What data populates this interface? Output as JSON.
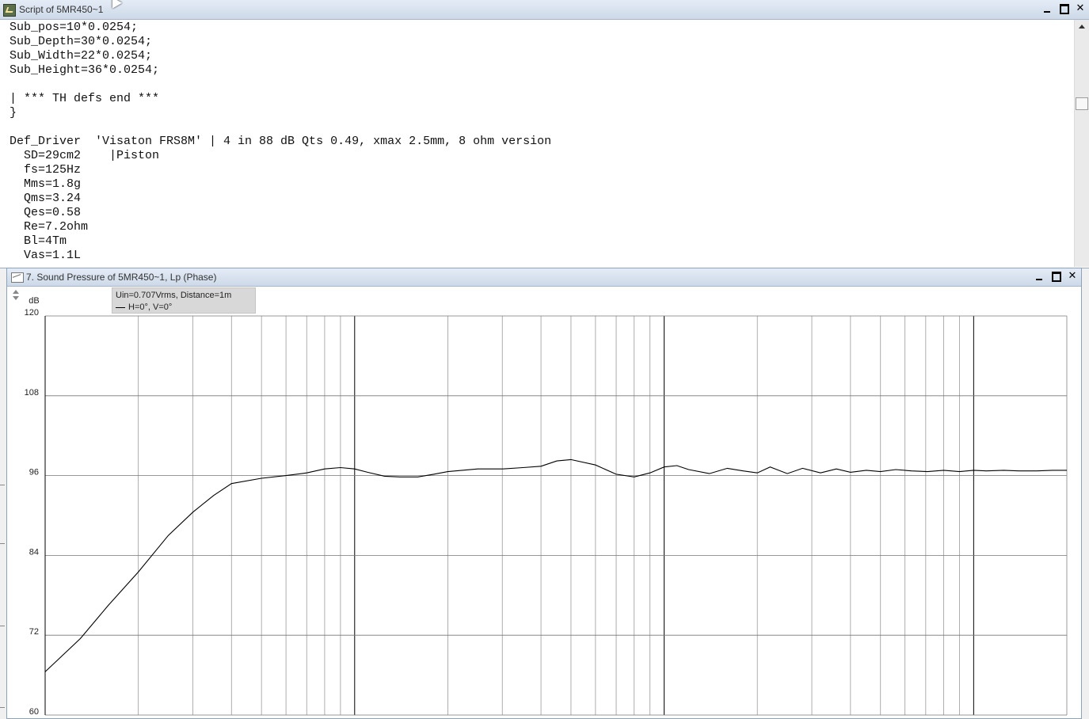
{
  "script_window": {
    "title": "Script of 5MR450~1",
    "lines": [
      "Sub_pos=10*0.0254;",
      "Sub_Depth=30*0.0254;",
      "Sub_Width=22*0.0254;",
      "Sub_Height=36*0.0254;",
      "",
      "| *** TH defs end ***",
      "}",
      "",
      "Def_Driver  'Visaton FRS8M' | 4 in 88 dB Qts 0.49, xmax 2.5mm, 8 ohm version",
      "  SD=29cm2    |Piston",
      "  fs=125Hz",
      "  Mms=1.8g",
      "  Qms=3.24",
      "  Qes=0.58",
      "  Re=7.2ohm",
      "  Bl=4Tm",
      "  Vas=1.1L"
    ]
  },
  "chart_window": {
    "title": "7. Sound Pressure of 5MR450~1, Lp (Phase)",
    "legend": {
      "conditions": "Uin=0.707Vrms, Distance=1m",
      "series_label": "H=0°, V=0°"
    }
  },
  "window_buttons": {
    "minimize": "",
    "maximize": "",
    "close": "✕"
  },
  "chart_data": {
    "type": "line",
    "ylabel": "dB",
    "ylim": [
      60,
      120
    ],
    "y_ticks": [
      60,
      72,
      84,
      96,
      108,
      120
    ],
    "x_scale": "log",
    "xlim": [
      10,
      20000
    ],
    "line_color": "#000000",
    "grid": true,
    "series": [
      {
        "name": "H=0°, V=0°",
        "x": [
          10,
          13,
          16,
          20,
          25,
          30,
          35,
          40,
          50,
          60,
          70,
          80,
          90,
          100,
          110,
          125,
          140,
          160,
          180,
          200,
          250,
          300,
          350,
          400,
          450,
          500,
          600,
          700,
          800,
          900,
          1000,
          1100,
          1200,
          1400,
          1600,
          1800,
          2000,
          2200,
          2500,
          2800,
          3200,
          3600,
          4000,
          4500,
          5000,
          5600,
          6300,
          7100,
          8000,
          9000,
          10000,
          11000,
          12500,
          14000,
          16000,
          18000,
          20000
        ],
        "y": [
          66.5,
          71.5,
          76.5,
          81.5,
          87,
          90.5,
          93,
          94.8,
          95.6,
          96,
          96.4,
          97,
          97.2,
          97,
          96.5,
          95.9,
          95.8,
          95.8,
          96.2,
          96.6,
          97,
          97,
          97.2,
          97.4,
          98.2,
          98.4,
          97.6,
          96.2,
          95.8,
          96.4,
          97.3,
          97.5,
          96.9,
          96.3,
          97.1,
          96.7,
          96.4,
          97.3,
          96.3,
          97.1,
          96.4,
          97.0,
          96.5,
          96.8,
          96.6,
          96.9,
          96.7,
          96.6,
          96.8,
          96.6,
          96.8,
          96.7,
          96.8,
          96.7,
          96.7,
          96.8,
          96.8
        ]
      }
    ]
  }
}
